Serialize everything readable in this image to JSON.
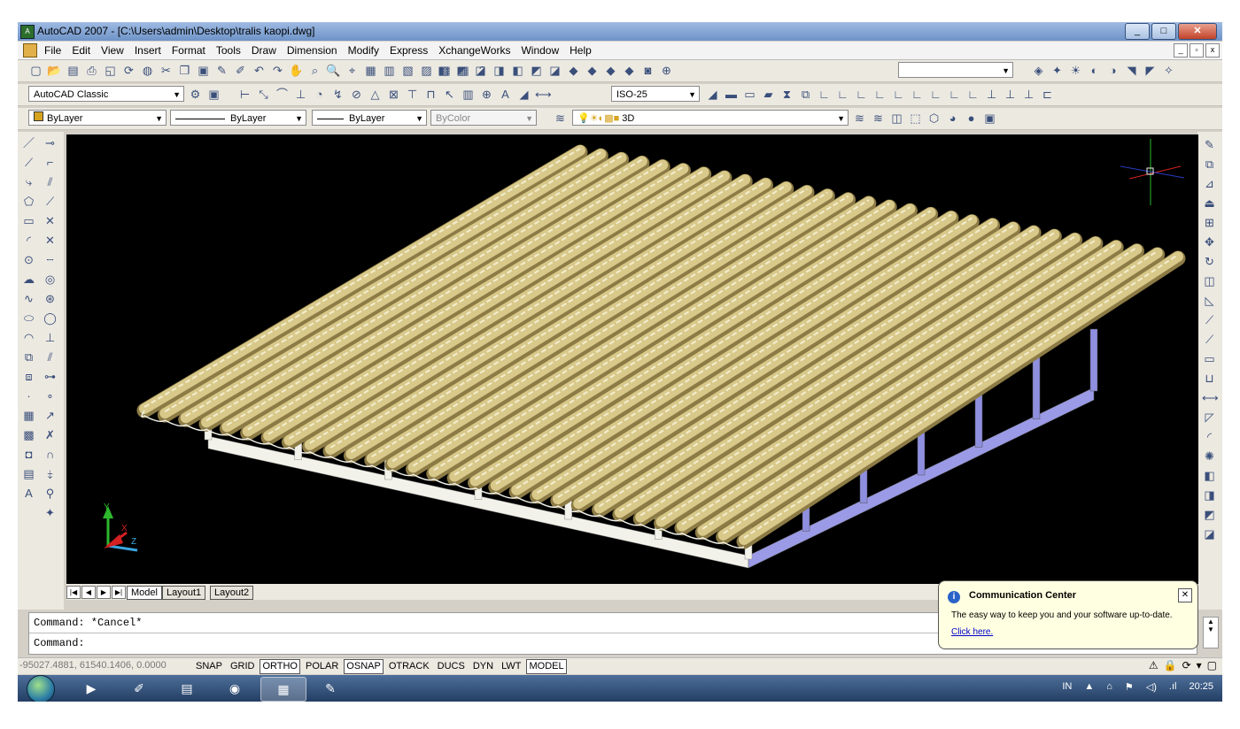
{
  "window": {
    "title": "AutoCAD 2007 - [C:\\Users\\admin\\Desktop\\tralis kaopi.dwg]"
  },
  "menu": {
    "items": [
      "File",
      "Edit",
      "View",
      "Insert",
      "Format",
      "Tools",
      "Draw",
      "Dimension",
      "Modify",
      "Express",
      "XchangeWorks",
      "Window",
      "Help"
    ]
  },
  "toolbars": {
    "workspace": "AutoCAD Classic",
    "dim_style": "ISO-25",
    "layer": "ByLayer",
    "linetype": "ByLayer",
    "lineweight": "ByLayer",
    "plot_style": "ByColor",
    "layer_state": "3D"
  },
  "layout_tabs": {
    "model": "Model",
    "layout1": "Layout1",
    "layout2": "Layout2"
  },
  "ucs": {
    "x_label": "X",
    "y_label": "Y",
    "z_label": "Z"
  },
  "command": {
    "line1": "Command: *Cancel*",
    "line2": "Command:"
  },
  "status": {
    "coordinates": "-95027.4881, 61540.1406, 0.0000",
    "buttons": [
      "SNAP",
      "GRID",
      "ORTHO",
      "POLAR",
      "OSNAP",
      "OTRACK",
      "DUCS",
      "DYN",
      "LWT",
      "MODEL"
    ],
    "active_buttons": [
      "ORTHO",
      "OSNAP",
      "MODEL"
    ]
  },
  "communication_center": {
    "title": "Communication Center",
    "message": "The easy way to keep you and your software up-to-date.",
    "link": "Click here."
  },
  "taskbar": {
    "language": "IN",
    "time": "20:25"
  },
  "drawing": {
    "roof_color": "#d8c98a",
    "frame_color": "#f2f2ea",
    "post_color": "#8f8fe0",
    "background": "#000000",
    "corrugation_count": 30
  }
}
